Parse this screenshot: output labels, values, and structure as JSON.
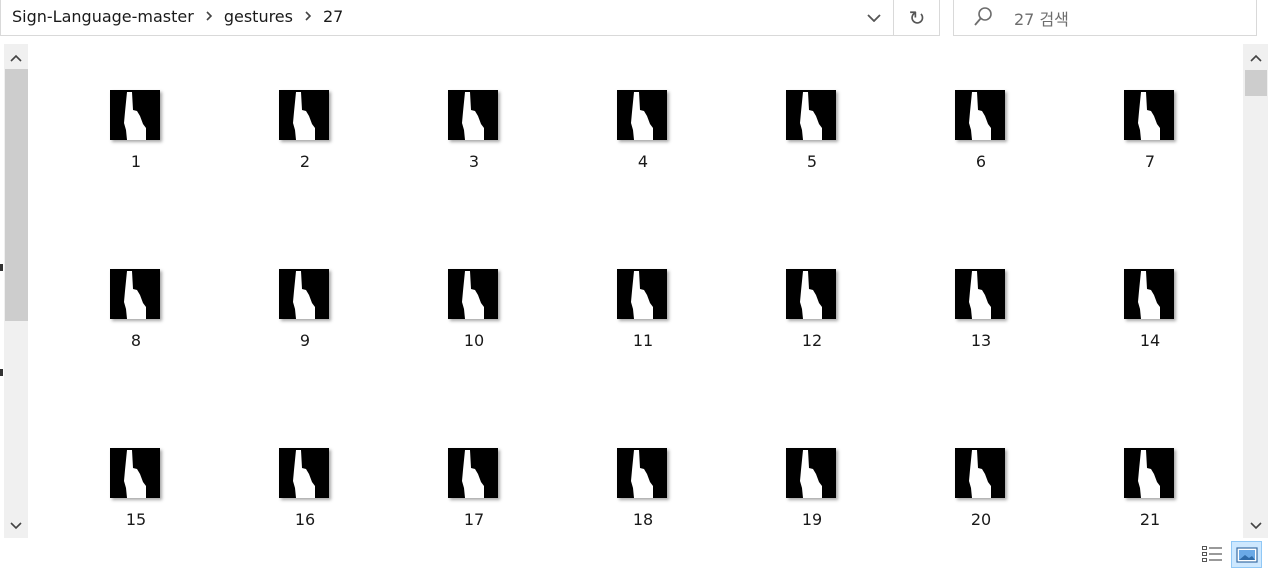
{
  "breadcrumb": {
    "items": [
      "Sign-Language-master",
      "gestures",
      "27"
    ]
  },
  "search": {
    "placeholder": "27 검색"
  },
  "icons": {
    "refresh": "↻",
    "dropdown": "chevron-down-icon",
    "search": "search-icon"
  },
  "files": [
    {
      "name": "1"
    },
    {
      "name": "2"
    },
    {
      "name": "3"
    },
    {
      "name": "4"
    },
    {
      "name": "5"
    },
    {
      "name": "6"
    },
    {
      "name": "7"
    },
    {
      "name": "8"
    },
    {
      "name": "9"
    },
    {
      "name": "10"
    },
    {
      "name": "11"
    },
    {
      "name": "12"
    },
    {
      "name": "13"
    },
    {
      "name": "14"
    },
    {
      "name": "15"
    },
    {
      "name": "16"
    },
    {
      "name": "17"
    },
    {
      "name": "18"
    },
    {
      "name": "19"
    },
    {
      "name": "20"
    },
    {
      "name": "21"
    }
  ],
  "colors": {
    "selection_bg": "#cde8ff",
    "selection_border": "#90c8f6"
  }
}
